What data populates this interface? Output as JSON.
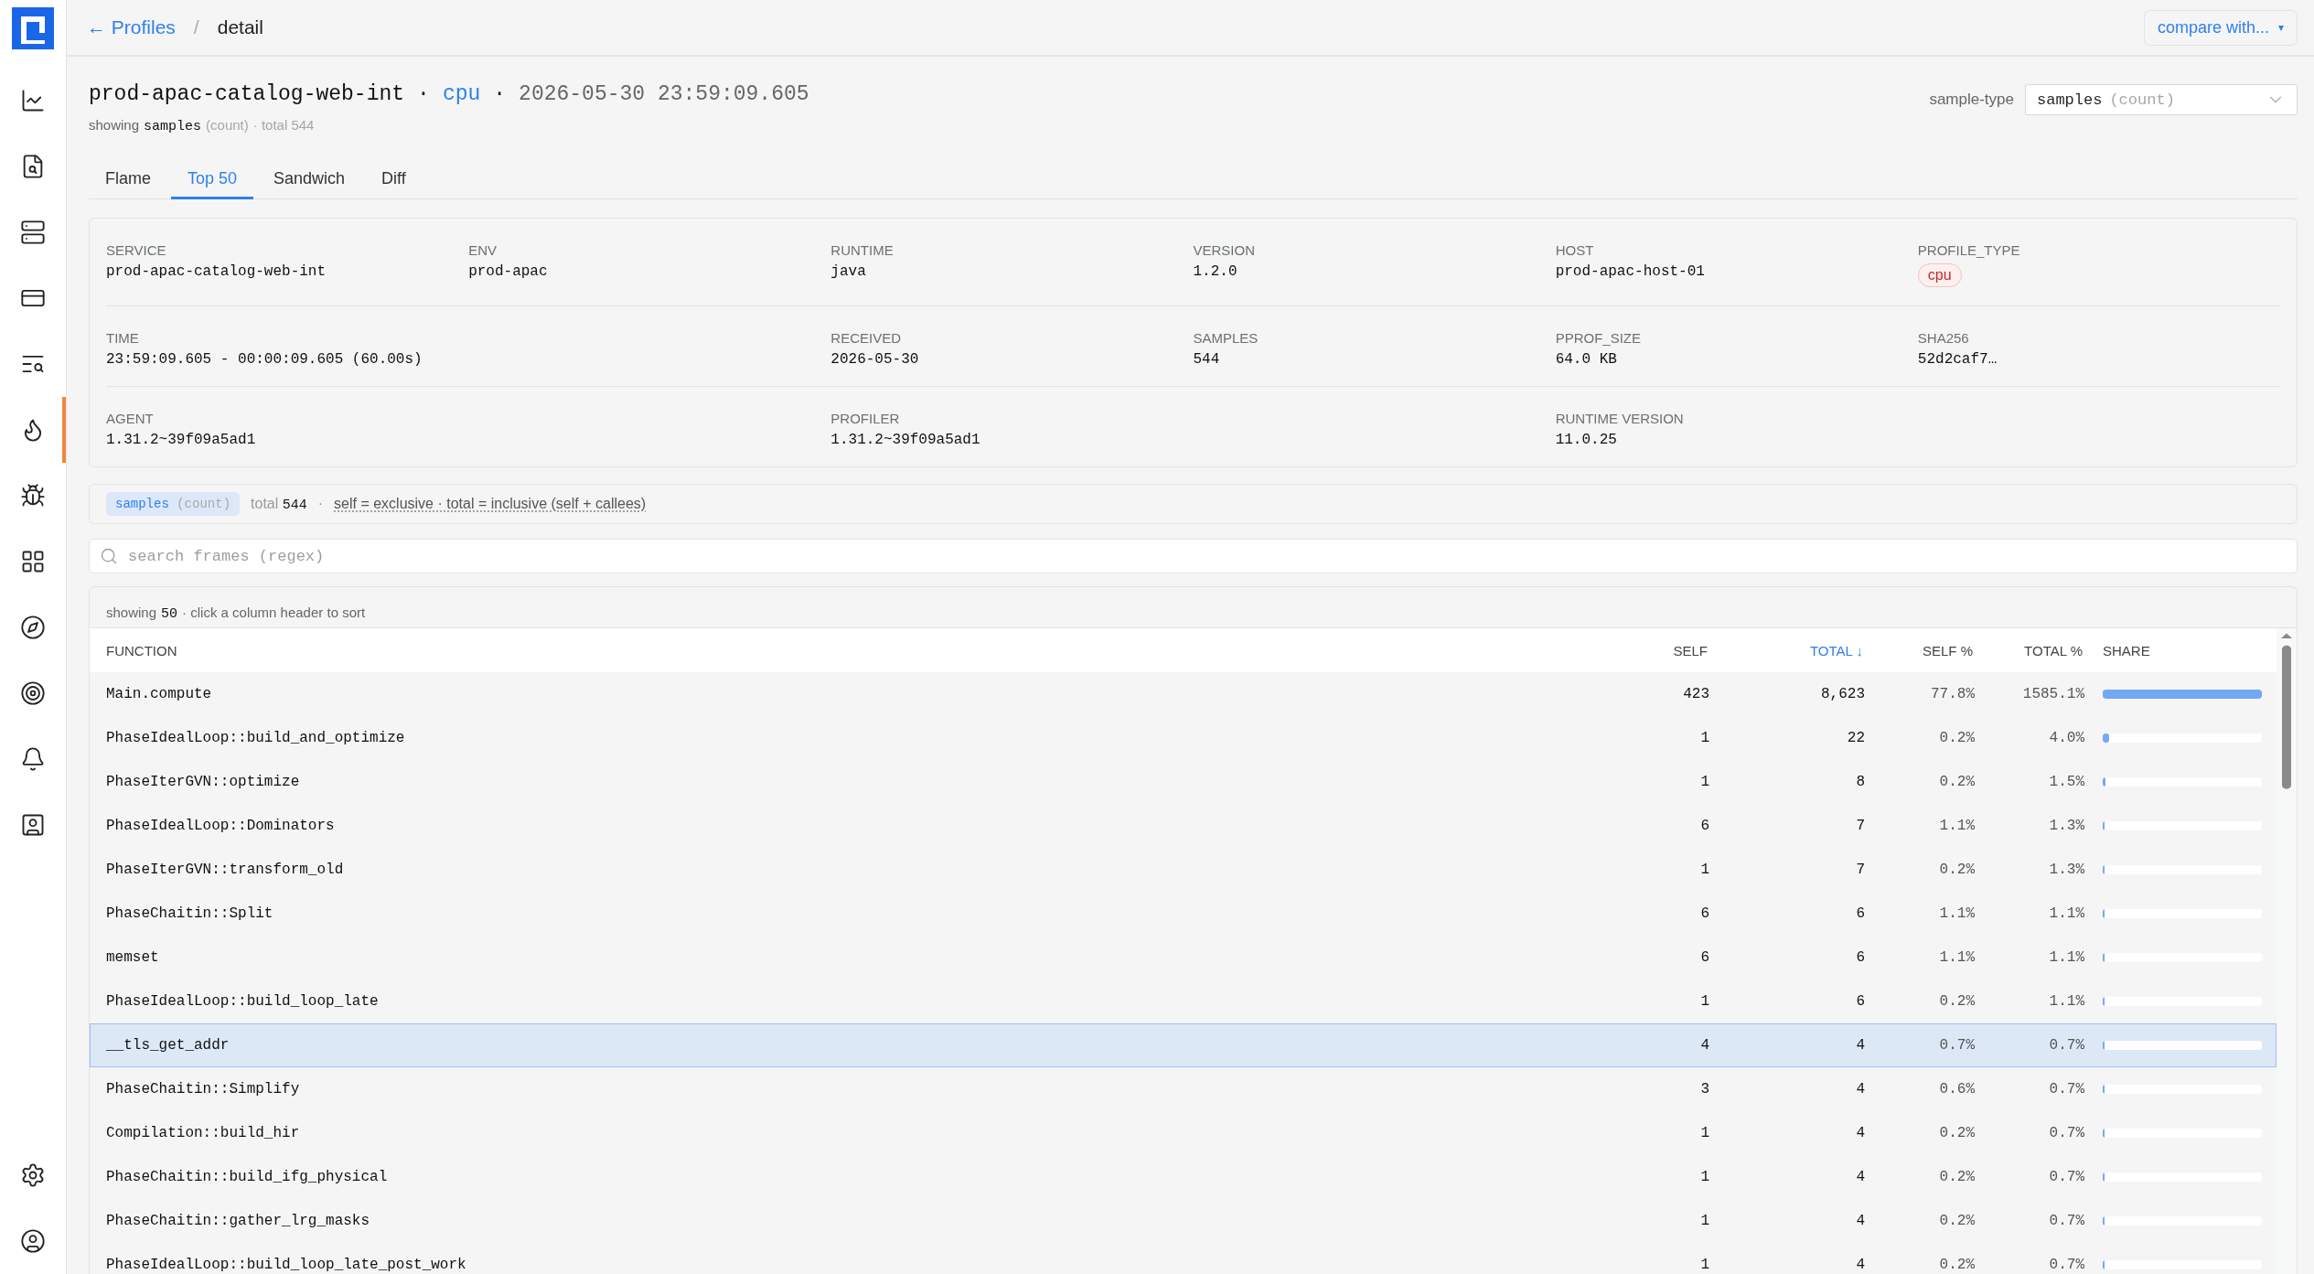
{
  "sidebar": {
    "items": [
      {
        "selected": false
      },
      {
        "selected": false
      },
      {
        "selected": false
      },
      {
        "selected": false
      },
      {
        "selected": false
      },
      {
        "selected": true
      },
      {
        "selected": false
      },
      {
        "selected": false
      },
      {
        "selected": false
      },
      {
        "selected": false
      },
      {
        "selected": false
      },
      {
        "selected": false
      }
    ],
    "bottom_items": [
      {
        "selected": false
      },
      {
        "selected": false
      }
    ]
  },
  "breadcrumb": {
    "back_link": "← Profiles",
    "separator": "/",
    "current": "detail"
  },
  "compare_button": {
    "label": "compare with...",
    "caret": "▾"
  },
  "title": [
    {
      "text": "prod-apac-catalog-web-int",
      "kind": "name"
    },
    {
      "text": "·",
      "kind": "sep"
    },
    {
      "text": "cpu",
      "kind": "type"
    },
    {
      "text": "·",
      "kind": "sep"
    },
    {
      "text": "2026-05-30 23:59:09.605",
      "kind": "time"
    }
  ],
  "subtitle": [
    {
      "text": "showing",
      "kind": "plain"
    },
    {
      "text": "samples",
      "kind": "code"
    },
    {
      "text": "(count)",
      "kind": "muted"
    },
    {
      "text": "· total 544",
      "kind": "muted"
    }
  ],
  "sample_type": {
    "label": "sample-type",
    "value": "samples",
    "unit": "(count)"
  },
  "tabs": [
    {
      "label": "Flame",
      "selected": false
    },
    {
      "label": "Top 50",
      "selected": true
    },
    {
      "label": "Sandwich",
      "selected": false
    },
    {
      "label": "Diff",
      "selected": false
    }
  ],
  "metadata": [
    [
      {
        "label": "SERVICE",
        "value": "prod-apac-catalog-web-int",
        "kind": "text"
      },
      {
        "label": "ENV",
        "value": "prod-apac",
        "kind": "text"
      },
      {
        "label": "RUNTIME",
        "value": "java",
        "kind": "text"
      },
      {
        "label": "VERSION",
        "value": "1.2.0",
        "kind": "text"
      },
      {
        "label": "HOST",
        "value": "prod-apac-host-01",
        "kind": "text"
      },
      {
        "label": "PROFILE_TYPE",
        "value": "cpu",
        "kind": "badge"
      }
    ],
    [
      {
        "label": "TIME",
        "value": "23:59:09.605 - 00:00:09.605 (60.00s)",
        "kind": "wide"
      },
      {
        "label": "RECEIVED",
        "value": "2026-05-30",
        "kind": "text"
      },
      {
        "label": "SAMPLES",
        "value": "544",
        "kind": "text"
      },
      {
        "label": "PPROF_SIZE",
        "value": "64.0 KB",
        "kind": "text"
      },
      {
        "label": "SHA256",
        "value": "52d2caf7…",
        "kind": "text"
      }
    ],
    [
      {
        "label": "AGENT",
        "value": "1.31.2~39f09a5ad1",
        "kind": "wide"
      },
      {
        "label": "PROFILER",
        "value": "1.31.2~39f09a5ad1",
        "kind": "wide"
      },
      {
        "label": "RUNTIME VERSION",
        "value": "11.0.25",
        "kind": "text"
      }
    ]
  ],
  "summary": {
    "chip_value": "samples",
    "chip_unit": "(count)",
    "total_label": "total",
    "total_value": "544",
    "separator": "·",
    "legend": "self = exclusive · total = inclusive (self + callees)"
  },
  "search": {
    "placeholder": "search frames (regex)"
  },
  "table": {
    "caption": [
      {
        "text": "showing",
        "kind": "plain"
      },
      {
        "text": "50",
        "kind": "code"
      },
      {
        "text": "· click a column header to sort",
        "kind": "plain"
      }
    ],
    "columns": [
      {
        "label": "FUNCTION",
        "sorted": false
      },
      {
        "label": "SELF",
        "sorted": false
      },
      {
        "label": "TOTAL",
        "sorted": true,
        "sort_indicator": "↓"
      },
      {
        "label": "SELF %",
        "sorted": false
      },
      {
        "label": "TOTAL %",
        "sorted": false
      },
      {
        "label": "SHARE",
        "sorted": false
      }
    ],
    "rows": [
      {
        "function": "Main.compute",
        "self": "423",
        "total": "8,623",
        "self_pct": "77.8%",
        "total_pct": "1585.1%",
        "level": 1,
        "selected": false
      },
      {
        "function": "PhaseIdealLoop::build_and_optimize",
        "self": "1",
        "total": "22",
        "self_pct": "0.2%",
        "total_pct": "4.0%",
        "level": 0.04,
        "selected": false
      },
      {
        "function": "PhaseIterGVN::optimize",
        "self": "1",
        "total": "8",
        "self_pct": "0.2%",
        "total_pct": "1.5%",
        "level": 0.015,
        "selected": false
      },
      {
        "function": "PhaseIdealLoop::Dominators",
        "self": "6",
        "total": "7",
        "self_pct": "1.1%",
        "total_pct": "1.3%",
        "level": 0.013,
        "selected": false
      },
      {
        "function": "PhaseIterGVN::transform_old",
        "self": "1",
        "total": "7",
        "self_pct": "0.2%",
        "total_pct": "1.3%",
        "level": 0.013,
        "selected": false
      },
      {
        "function": "PhaseChaitin::Split",
        "self": "6",
        "total": "6",
        "self_pct": "1.1%",
        "total_pct": "1.1%",
        "level": 0.011,
        "selected": false
      },
      {
        "function": "memset",
        "self": "6",
        "total": "6",
        "self_pct": "1.1%",
        "total_pct": "1.1%",
        "level": 0.011,
        "selected": false
      },
      {
        "function": "PhaseIdealLoop::build_loop_late",
        "self": "1",
        "total": "6",
        "self_pct": "0.2%",
        "total_pct": "1.1%",
        "level": 0.011,
        "selected": false
      },
      {
        "function": "__tls_get_addr",
        "self": "4",
        "total": "4",
        "self_pct": "0.7%",
        "total_pct": "0.7%",
        "level": 0.007,
        "selected": true
      },
      {
        "function": "PhaseChaitin::Simplify",
        "self": "3",
        "total": "4",
        "self_pct": "0.6%",
        "total_pct": "0.7%",
        "level": 0.007,
        "selected": false
      },
      {
        "function": "Compilation::build_hir",
        "self": "1",
        "total": "4",
        "self_pct": "0.2%",
        "total_pct": "0.7%",
        "level": 0.007,
        "selected": false
      },
      {
        "function": "PhaseChaitin::build_ifg_physical",
        "self": "1",
        "total": "4",
        "self_pct": "0.2%",
        "total_pct": "0.7%",
        "level": 0.007,
        "selected": false
      },
      {
        "function": "PhaseChaitin::gather_lrg_masks",
        "self": "1",
        "total": "4",
        "self_pct": "0.2%",
        "total_pct": "0.7%",
        "level": 0.007,
        "selected": false
      },
      {
        "function": "PhaseIdealLoop::build_loop_late_post_work",
        "self": "1",
        "total": "4",
        "self_pct": "0.2%",
        "total_pct": "0.7%",
        "level": 0.007,
        "selected": false
      }
    ]
  }
}
